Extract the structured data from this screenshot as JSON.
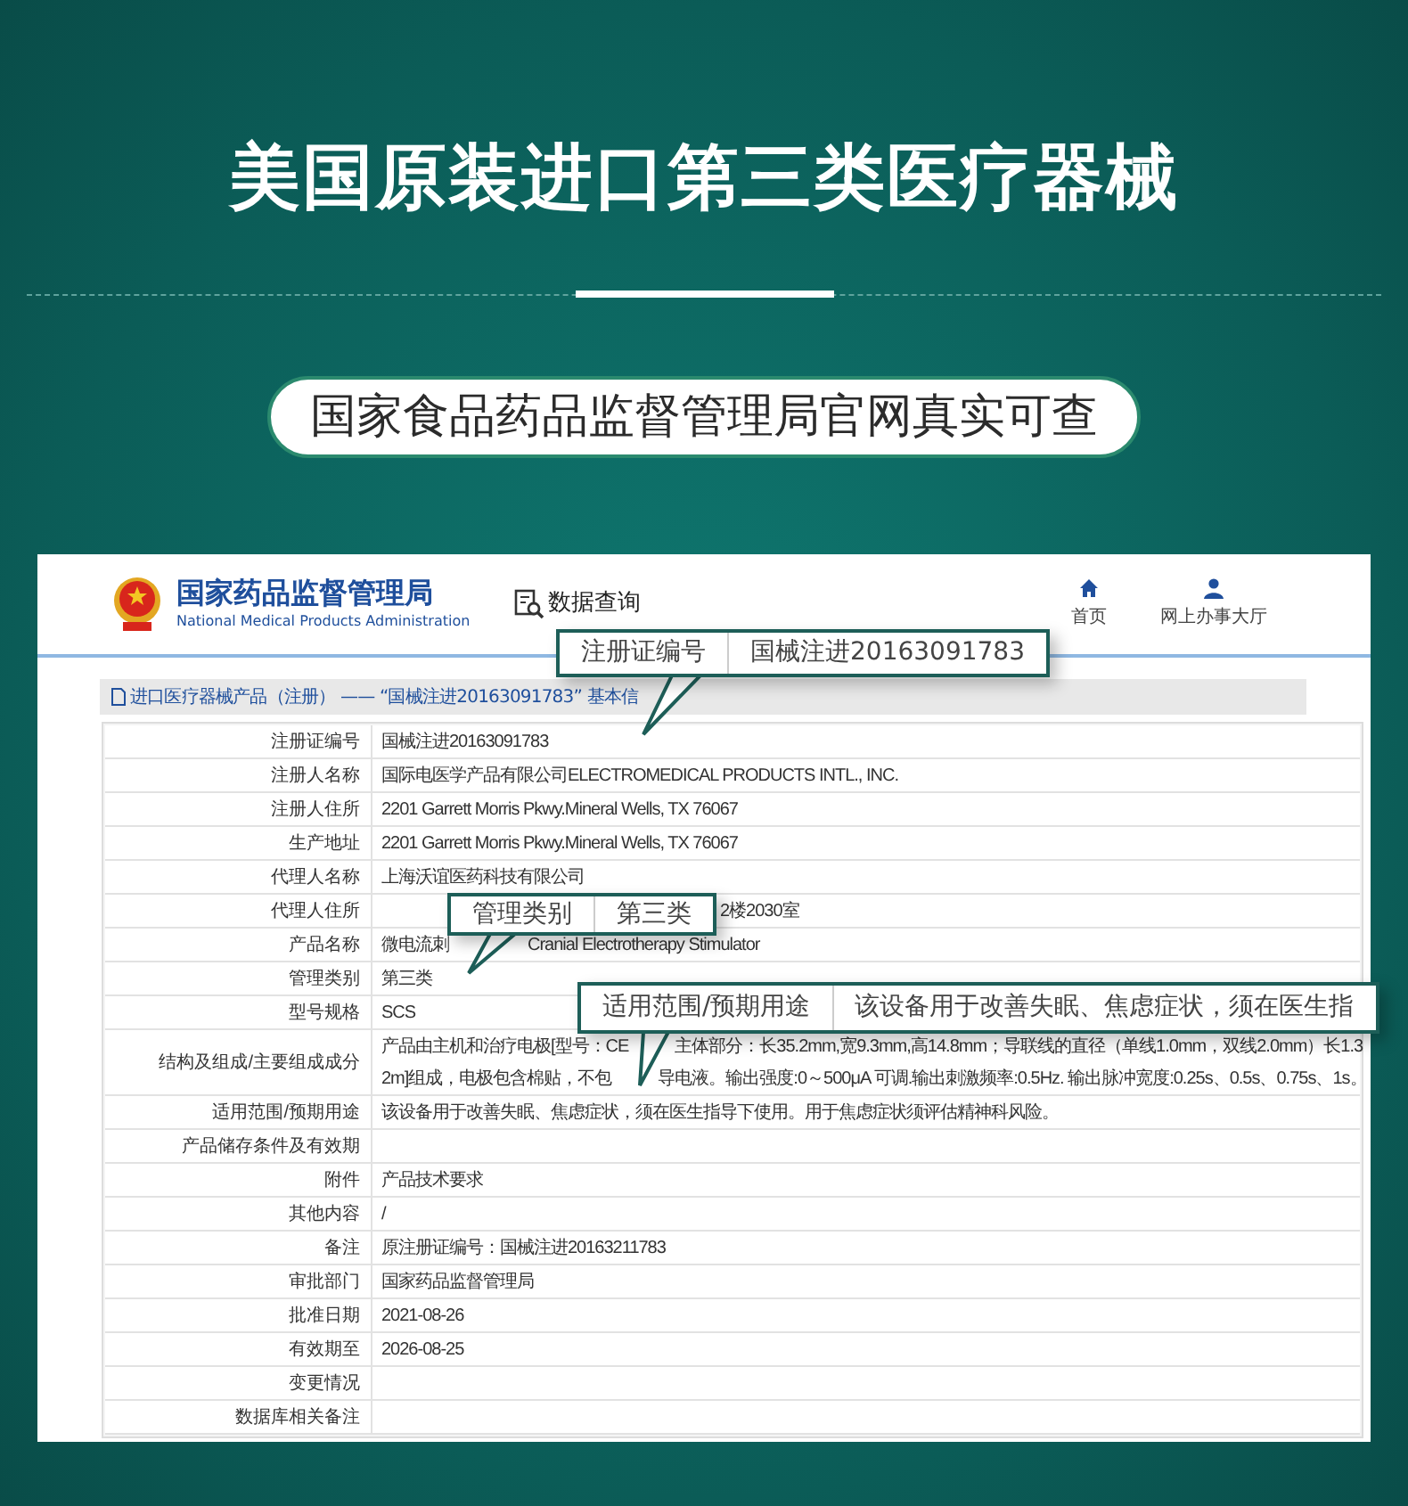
{
  "headline": "美国原装进口第三类医疗器械",
  "badge": "国家食品药品监督管理局官网真实可查",
  "site": {
    "name": "国家药品监督管理局",
    "name_en": "National Medical Products Administration",
    "search_link": "数据查询",
    "nav": [
      {
        "label": "首页"
      },
      {
        "label": "网上办事大厅"
      }
    ]
  },
  "breadcrumb": "进口医疗器械产品（注册） —— “国械注进20163091783” 基本信",
  "rows": [
    {
      "label": "注册证编号",
      "lines": [
        [
          "国械注进20163091783"
        ]
      ]
    },
    {
      "label": "注册人名称",
      "lines": [
        [
          "国际电医学产品有限公司ELECTROMEDICAL PRODUCTS INTL., INC."
        ]
      ]
    },
    {
      "label": "注册人住所",
      "lines": [
        [
          "2201 Garrett Morris Pkwy.Mineral Wells, TX 76067"
        ]
      ]
    },
    {
      "label": "生产地址",
      "lines": [
        [
          "2201 Garrett Morris Pkwy.Mineral Wells, TX 76067"
        ]
      ]
    },
    {
      "label": "代理人名称",
      "lines": [
        [
          "上海沃谊医药科技有限公司"
        ]
      ]
    },
    {
      "label": "代理人住所",
      "lines": [
        [
          "2楼2030室"
        ]
      ]
    },
    {
      "label": "产品名称",
      "lines": [
        [
          "微电流刺",
          "Cranial Electrotherapy Stimulator"
        ]
      ]
    },
    {
      "label": "管理类别",
      "lines": [
        [
          "第三类"
        ]
      ]
    },
    {
      "label": "型号规格",
      "lines": [
        [
          "SCS"
        ]
      ]
    },
    {
      "label": "结构及组成/主要组成成分",
      "lines": [
        [
          "产品由主机和治疗电极[型号：CE",
          "主体部分：长35.2mm,宽9.3mm,高14.8mm；导联线的直径（单线1.0mm，双线2.0mm）长1.3"
        ],
        [
          "2m]组成，电极包含棉贴，不包",
          "导电液。输出强度:0～500μA 可调.输出刺激频率:0.5Hz. 输出脉冲宽度:0.25s、0.5s、0.75s、1s。"
        ]
      ]
    },
    {
      "label": "适用范围/预期用途",
      "lines": [
        [
          "该设备用于改善失眠、焦虑症状，须在医生指导下使用。用于焦虑症状须评估精神科风险。"
        ]
      ]
    },
    {
      "label": "产品储存条件及有效期"
    },
    {
      "label": "附件",
      "lines": [
        [
          "产品技术要求"
        ]
      ]
    },
    {
      "label": "其他内容",
      "lines": [
        [
          "/"
        ]
      ]
    },
    {
      "label": "备注",
      "lines": [
        [
          "原注册证编号：国械注进20163211783"
        ]
      ]
    },
    {
      "label": "审批部门",
      "lines": [
        [
          "国家药品监督管理局"
        ]
      ]
    },
    {
      "label": "批准日期",
      "lines": [
        [
          "2021-08-26"
        ]
      ]
    },
    {
      "label": "有效期至",
      "lines": [
        [
          "2026-08-25"
        ]
      ]
    },
    {
      "label": "变更情况"
    },
    {
      "label": "数据库相关备注"
    }
  ],
  "callouts": [
    {
      "label": "注册证编号",
      "value": "国械注进20163091783"
    },
    {
      "label": "管理类别",
      "value": "第三类"
    },
    {
      "label": "适用范围/预期用途",
      "value": "该设备用于改善失眠、焦虑症状，须在医生指"
    }
  ]
}
